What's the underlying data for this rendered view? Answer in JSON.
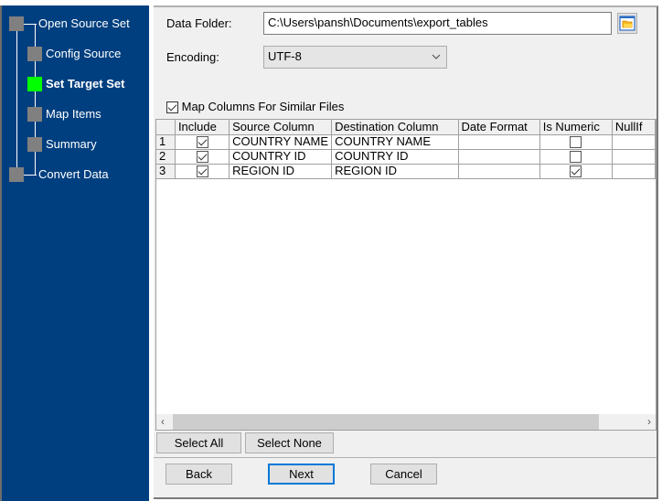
{
  "wizard_steps": [
    {
      "label": "Open Source Set",
      "state": "pending"
    },
    {
      "label": "Config Source",
      "state": "pending"
    },
    {
      "label": "Set Target Set",
      "state": "current"
    },
    {
      "label": "Map Items",
      "state": "pending"
    },
    {
      "label": "Summary",
      "state": "pending"
    },
    {
      "label": "Convert Data",
      "state": "pending"
    }
  ],
  "colors": {
    "sidebar": "#003f7f",
    "current_step": "#00ff00",
    "pending_step": "#808080",
    "focus": "#0078d7"
  },
  "form": {
    "data_folder_label": "Data Folder:",
    "data_folder_value": "C:\\Users\\pansh\\Documents\\export_tables",
    "browse_icon": "folder-icon",
    "encoding_label": "Encoding:",
    "encoding_value": "UTF-8",
    "map_similar_label": "Map Columns For Similar Files",
    "map_similar_checked": true
  },
  "grid": {
    "columns": [
      "Include",
      "Source Column",
      "Destination Column",
      "Date Format",
      "Is Numeric",
      "NullIf"
    ],
    "rows": [
      {
        "num": "1",
        "include": true,
        "source": "COUNTRY NAME",
        "dest": "COUNTRY NAME",
        "date_format": "",
        "numeric": false,
        "nullif": ""
      },
      {
        "num": "2",
        "include": true,
        "source": "COUNTRY ID",
        "dest": "COUNTRY ID",
        "date_format": "",
        "numeric": false,
        "nullif": ""
      },
      {
        "num": "3",
        "include": true,
        "source": "REGION ID",
        "dest": "REGION ID",
        "date_format": "",
        "numeric": true,
        "nullif": ""
      }
    ]
  },
  "buttons": {
    "select_all": "Select All",
    "select_none": "Select None",
    "back": "Back",
    "next": "Next",
    "cancel": "Cancel"
  }
}
